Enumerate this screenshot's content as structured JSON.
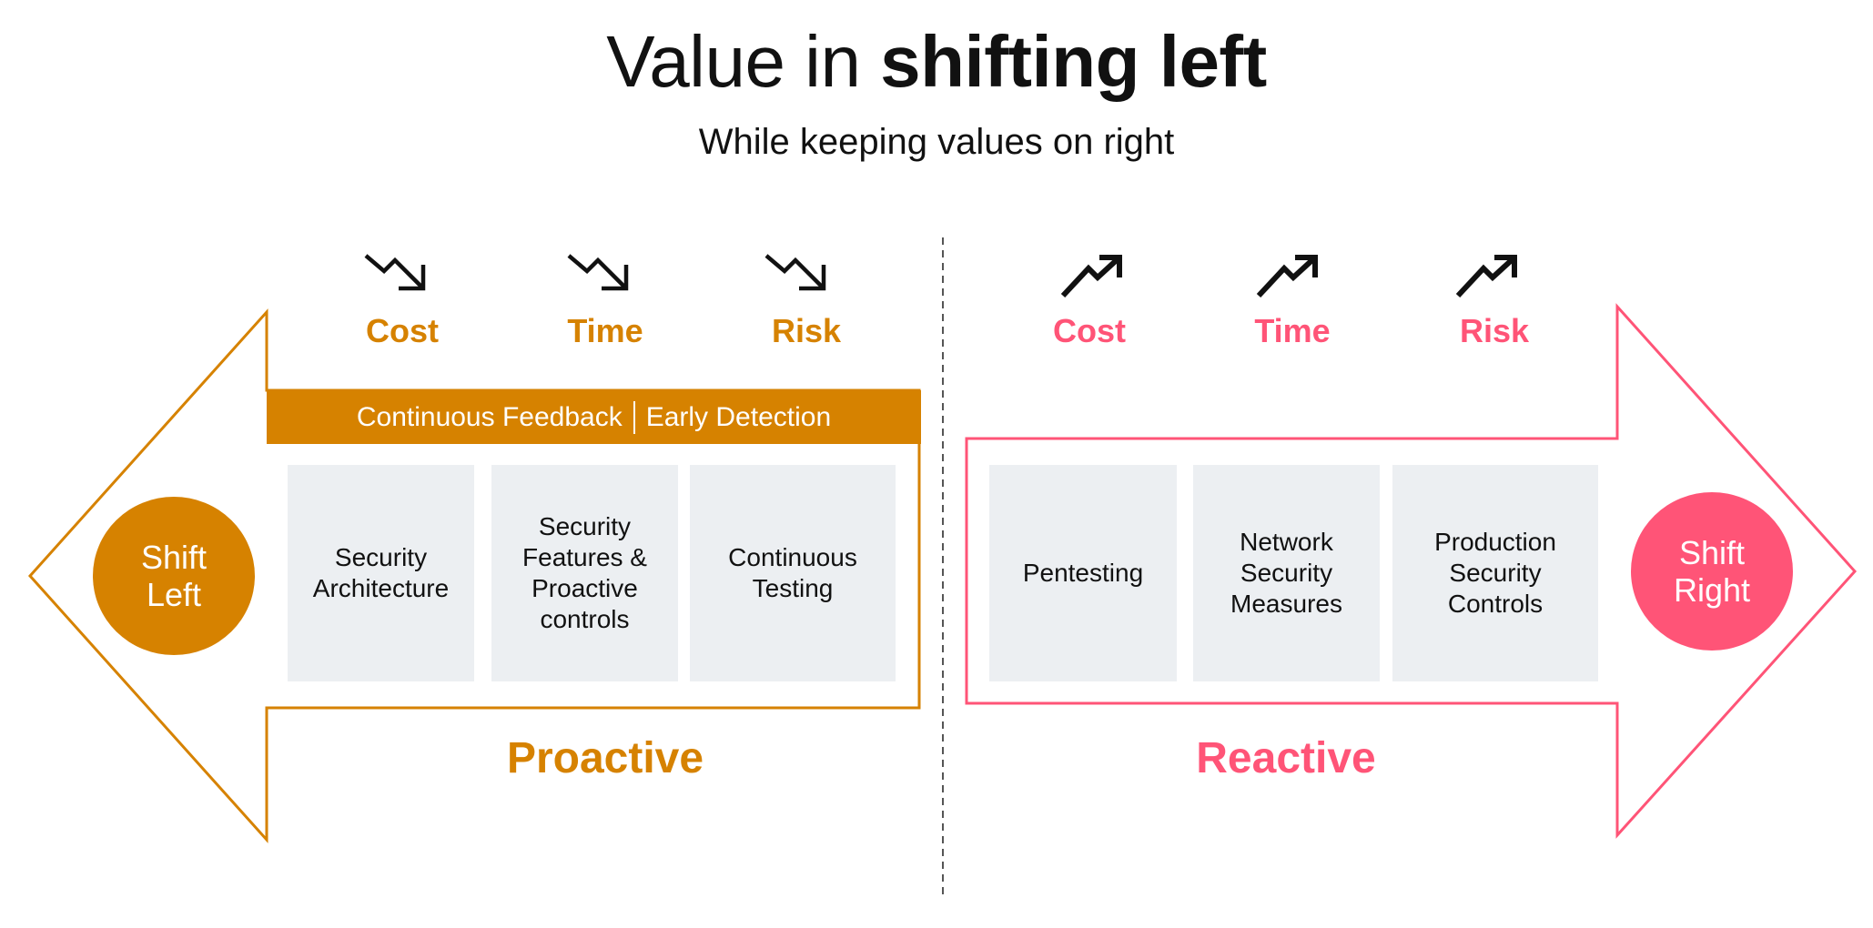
{
  "header": {
    "title_regular": "Value in ",
    "title_bold": "shifting left",
    "subtitle": "While keeping values on right"
  },
  "colors": {
    "proactive": "#d68200",
    "reactive": "#ff5477",
    "box_fill": "#eceff2",
    "divider": "#555555"
  },
  "left": {
    "metrics": [
      {
        "label": "Cost",
        "icon": "trending-down-icon"
      },
      {
        "label": "Time",
        "icon": "trending-down-icon"
      },
      {
        "label": "Risk",
        "icon": "trending-down-icon"
      }
    ],
    "band": {
      "part1": "Continuous Feedback",
      "part2": "Early Detection"
    },
    "boxes": [
      "Security\nArchitecture",
      "Security\nFeatures &\nProactive\ncontrols",
      "Continuous\nTesting"
    ],
    "circle": "Shift\nLeft",
    "label": "Proactive"
  },
  "right": {
    "metrics": [
      {
        "label": "Cost",
        "icon": "trending-up-icon"
      },
      {
        "label": "Time",
        "icon": "trending-up-icon"
      },
      {
        "label": "Risk",
        "icon": "trending-up-icon"
      }
    ],
    "boxes": [
      "Pentesting",
      "Network\nSecurity\nMeasures",
      "Production\nSecurity\nControls"
    ],
    "circle": "Shift\nRight",
    "label": "Reactive"
  }
}
